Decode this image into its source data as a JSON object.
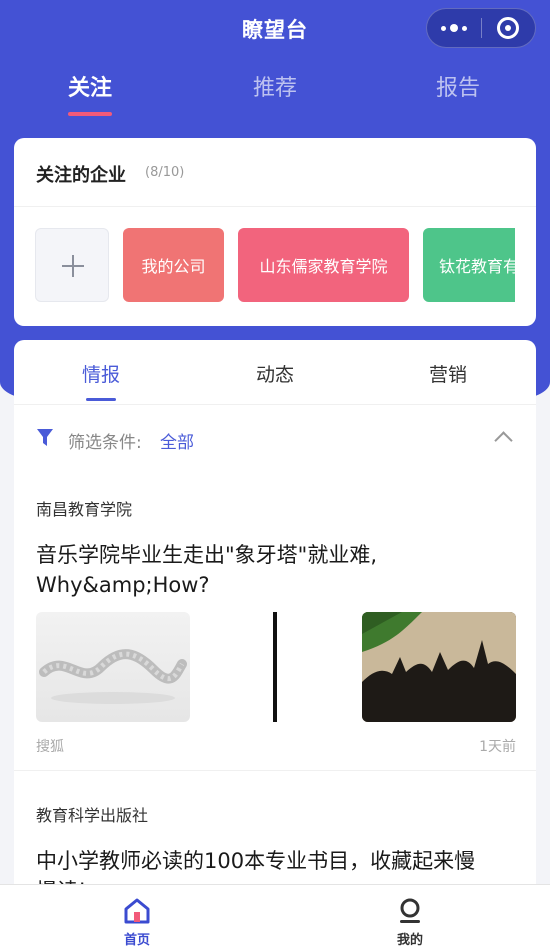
{
  "app": {
    "title": "瞭望台"
  },
  "colors": {
    "brand": "#4452d4",
    "accent_pink": "#f25a7a",
    "link_blue": "#4a5bd8"
  },
  "top_tabs": [
    {
      "label": "关注",
      "active": true
    },
    {
      "label": "推荐",
      "active": false
    },
    {
      "label": "报告",
      "active": false
    }
  ],
  "followed": {
    "title": "关注的企业",
    "count": "(8/10)",
    "chips": [
      {
        "label": "我的公司",
        "color": "#f07474"
      },
      {
        "label": "山东儒家教育学院",
        "color": "#f2647d"
      },
      {
        "label": "钛花教育有",
        "color": "#4ec58a"
      }
    ]
  },
  "sub_tabs": [
    {
      "label": "情报",
      "active": true
    },
    {
      "label": "动态",
      "active": false
    },
    {
      "label": "营销",
      "active": false
    }
  ],
  "filter": {
    "label": "筛选条件:",
    "value": "全部"
  },
  "articles": [
    {
      "source": "南昌教育学院",
      "headline_line1": "音乐学院毕业生走出\"象牙塔\"就业难,",
      "headline_line2": "Why&amp;How?",
      "media": "搜狐",
      "time": "1天前"
    },
    {
      "source": "教育科学出版社",
      "headline_line1": "中小学教师必读的100本专业书目，收藏起来慢",
      "headline_line2": "慢读!"
    }
  ],
  "bottom_nav": [
    {
      "label": "首页",
      "icon": "home-icon",
      "active": true
    },
    {
      "label": "我的",
      "icon": "profile-icon",
      "active": false
    }
  ]
}
